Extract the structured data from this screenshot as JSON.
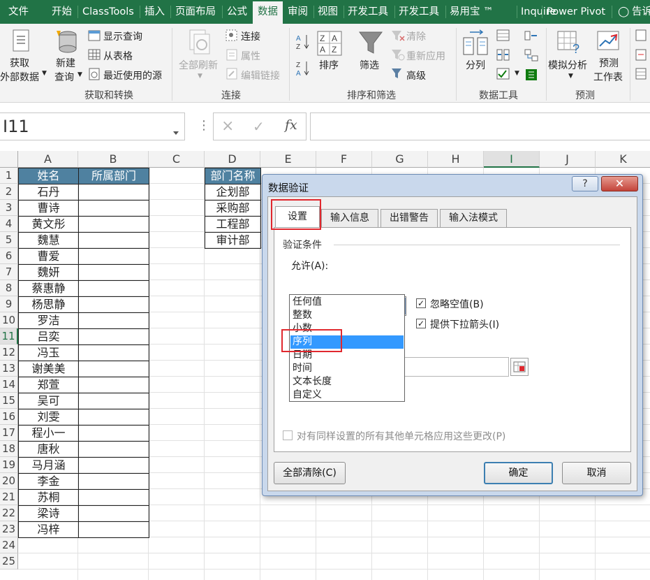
{
  "ribbon_tabs": [
    "文件",
    "开始",
    "ClassTools",
    "插入",
    "页面布局",
    "公式",
    "数据",
    "审阅",
    "视图",
    "开发工具",
    "开发工具",
    "易用宝 ™",
    "Inquire",
    "Power Pivot",
    "告诉"
  ],
  "active_tab": "数据",
  "ribbon": {
    "get_external_data": [
      "获取",
      "外部数据"
    ],
    "new_query": [
      "新建",
      "查询"
    ],
    "show_queries": "显示查询",
    "from_table": "从表格",
    "recent_sources": "最近使用的源",
    "group_get_transform": "获取和转换",
    "refresh_all": "全部刷新",
    "connections": "连接",
    "properties": "属性",
    "edit_links": "编辑链接",
    "group_connections": "连接",
    "sort": "排序",
    "filter": "筛选",
    "clear": "清除",
    "reapply": "重新应用",
    "advanced": "高级",
    "group_sort_filter": "排序和筛选",
    "text_to_columns": "分列",
    "group_data_tools": "数据工具",
    "what_if": "模拟分析",
    "forecast_sheet": [
      "预测",
      "工作表"
    ],
    "group_forecast": "预测"
  },
  "formula_bar": {
    "name_box": "I11",
    "cancel_icon": "×",
    "enter_icon": "✓",
    "fx_label": "fx",
    "formula": ""
  },
  "sheet": {
    "columns": [
      "A",
      "B",
      "C",
      "D",
      "E",
      "F",
      "G",
      "H",
      "I",
      "J",
      "K"
    ],
    "selected_column": "I",
    "selected_row": 11,
    "rows": [
      "1",
      "2",
      "3",
      "4",
      "5",
      "6",
      "7",
      "8",
      "9",
      "10",
      "11",
      "12",
      "13",
      "14",
      "15",
      "16",
      "17",
      "18",
      "19",
      "20",
      "21",
      "22",
      "23",
      "24",
      "25"
    ],
    "header_a": "姓名",
    "header_b": "所属部门",
    "header_d": "部门名称",
    "names": [
      "石丹",
      "曹诗",
      "黄文彤",
      "魏慧",
      "曹爱",
      "魏妍",
      "蔡惠静",
      "杨思静",
      "罗洁",
      "吕奕",
      "冯玉",
      "谢美美",
      "郑萱",
      "吴可",
      "刘雯",
      "程小一",
      "唐秋",
      "马月涵",
      "李金",
      "苏桐",
      "梁诗",
      "冯梓"
    ],
    "departments": [
      "企划部",
      "采购部",
      "工程部",
      "审计部"
    ]
  },
  "dialog": {
    "title": "数据验证",
    "help_icon": "?",
    "close_icon": "✕",
    "tabs": [
      "设置",
      "输入信息",
      "出错警告",
      "输入法模式"
    ],
    "active_tab": "设置",
    "section_title": "验证条件",
    "allow_label": "允许(A):",
    "allow_value": "序列",
    "ignore_blank": "忽略空值(B)",
    "ignore_blank_checked": true,
    "in_cell_dropdown": "提供下拉箭头(I)",
    "in_cell_dropdown_checked": true,
    "allow_options": [
      "任何值",
      "整数",
      "小数",
      "序列",
      "日期",
      "时间",
      "文本长度",
      "自定义"
    ],
    "selected_option": "序列",
    "apply_all_label": "对有同样设置的所有其他单元格应用这些更改(P)",
    "apply_all_checked": false,
    "clear_all_button": "全部清除(C)",
    "ok_button": "确定",
    "cancel_button": "取消"
  },
  "highlight_color": "#e0282e",
  "accent_color": "#217346",
  "table_header_color": "#4f81a0"
}
